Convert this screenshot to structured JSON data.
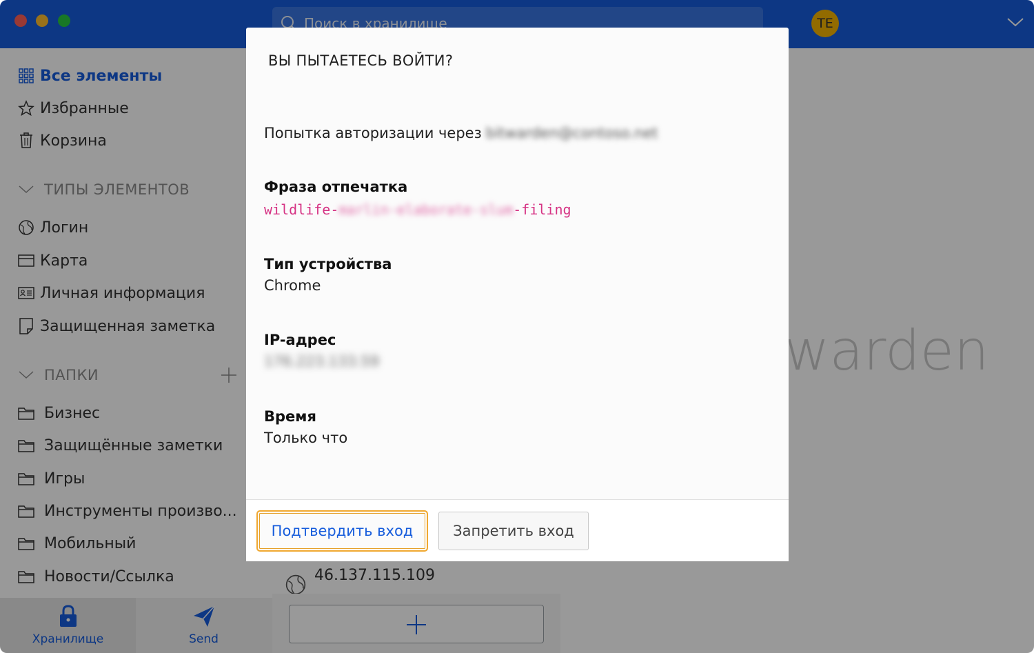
{
  "titlebar": {
    "search_placeholder": "Поиск в хранилище",
    "avatar_initials": "TE",
    "accent_color": "#175ddc"
  },
  "sidebar": {
    "filters": [
      {
        "label": "Все элементы",
        "icon": "grid-icon",
        "active": true
      },
      {
        "label": "Избранные",
        "icon": "star-icon"
      },
      {
        "label": "Корзина",
        "icon": "trash-icon"
      }
    ],
    "types_header": "ТИПЫ ЭЛЕМЕНТОВ",
    "types": [
      {
        "label": "Логин",
        "icon": "globe-icon"
      },
      {
        "label": "Карта",
        "icon": "credit-card-icon"
      },
      {
        "label": "Личная информация",
        "icon": "id-card-icon"
      },
      {
        "label": "Защищенная заметка",
        "icon": "note-icon"
      }
    ],
    "folders_header": "ПАПКИ",
    "folders": [
      {
        "label": "Бизнес"
      },
      {
        "label": "Защищённые заметки"
      },
      {
        "label": "Игры"
      },
      {
        "label": "Инструменты произво..."
      },
      {
        "label": "Мобильный"
      },
      {
        "label": "Новости/Ссылка"
      }
    ]
  },
  "list": {
    "visible_item": "46.137.115.109"
  },
  "brand_text": "warden",
  "bottom_tabs": {
    "vault": "Хранилище",
    "send": "Send"
  },
  "modal": {
    "title": "ВЫ ПЫТАЕТЕСЬ ВОЙТИ?",
    "auth_prefix": "Попытка авторизации через",
    "auth_email_blurred": "bitwarden@contoso.net",
    "fingerprint_label": "Фраза отпечатка",
    "fingerprint_start": "wildlife-",
    "fingerprint_middle_blurred": "marlin-elaborate-slum",
    "fingerprint_end": "-filing",
    "device_label": "Тип устройства",
    "device_value": "Chrome",
    "ip_label": "IP-адрес",
    "ip_value_blurred": "176.223.133.59",
    "time_label": "Время",
    "time_value": "Только что",
    "confirm_button": "Подтвердить вход",
    "deny_button": "Запретить вход"
  }
}
